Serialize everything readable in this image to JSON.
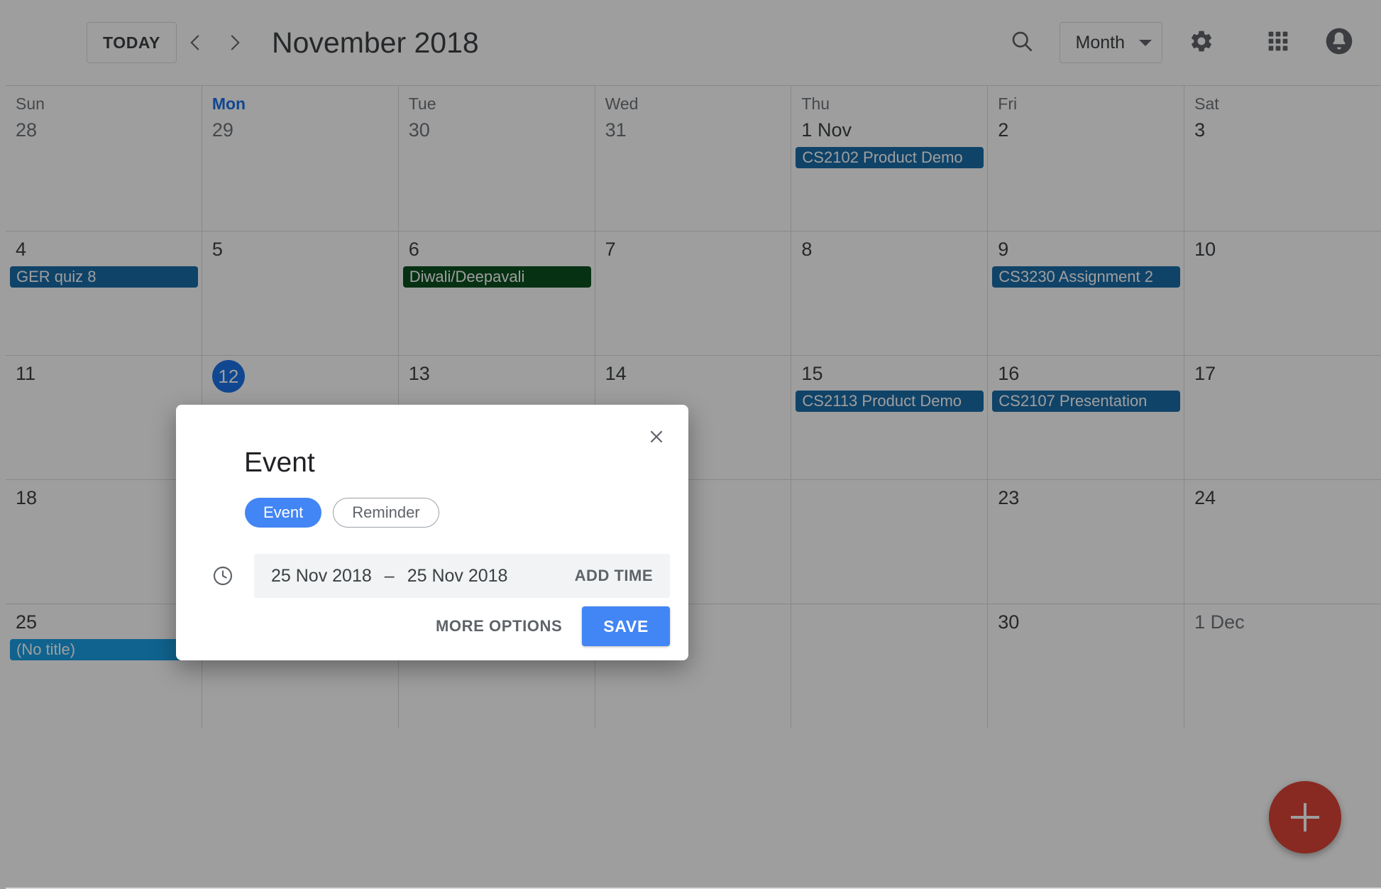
{
  "header": {
    "today_label": "TODAY",
    "prev_icon": "chevron-left-icon",
    "next_icon": "chevron-right-icon",
    "month_title": "November 2018",
    "search_icon": "search-icon",
    "view_label": "Month",
    "settings_icon": "gear-icon",
    "apps_icon": "apps-grid-icon",
    "notifications_icon": "bell-icon"
  },
  "calendar": {
    "day_headers": [
      "Sun",
      "Mon",
      "Tue",
      "Wed",
      "Thu",
      "Fri",
      "Sat"
    ],
    "today_dow_index": 1,
    "weeks": [
      {
        "days": [
          {
            "num": "28",
            "muted": true,
            "today": false,
            "events": []
          },
          {
            "num": "29",
            "muted": true,
            "today": false,
            "events": []
          },
          {
            "num": "30",
            "muted": true,
            "today": false,
            "events": []
          },
          {
            "num": "31",
            "muted": true,
            "today": false,
            "events": []
          },
          {
            "num": "1 Nov",
            "muted": false,
            "today": false,
            "events": [
              {
                "title": "CS2102 Product Demo",
                "color": "#1b6ca8"
              }
            ]
          },
          {
            "num": "2",
            "muted": false,
            "today": false,
            "events": []
          },
          {
            "num": "3",
            "muted": false,
            "today": false,
            "events": []
          }
        ]
      },
      {
        "days": [
          {
            "num": "4",
            "muted": false,
            "today": false,
            "events": [
              {
                "title": "GER quiz 8",
                "color": "#1b6ca8"
              }
            ]
          },
          {
            "num": "5",
            "muted": false,
            "today": false,
            "events": []
          },
          {
            "num": "6",
            "muted": false,
            "today": false,
            "events": [
              {
                "title": "Diwali/Deepavali",
                "color": "#0b5020"
              }
            ]
          },
          {
            "num": "7",
            "muted": false,
            "today": false,
            "events": []
          },
          {
            "num": "8",
            "muted": false,
            "today": false,
            "events": []
          },
          {
            "num": "9",
            "muted": false,
            "today": false,
            "events": [
              {
                "title": "CS3230 Assignment 2",
                "color": "#1b6ca8"
              }
            ]
          },
          {
            "num": "10",
            "muted": false,
            "today": false,
            "events": []
          }
        ]
      },
      {
        "days": [
          {
            "num": "11",
            "muted": false,
            "today": false,
            "events": []
          },
          {
            "num": "12",
            "muted": false,
            "today": true,
            "events": []
          },
          {
            "num": "13",
            "muted": false,
            "today": false,
            "events": []
          },
          {
            "num": "14",
            "muted": false,
            "today": false,
            "events": []
          },
          {
            "num": "15",
            "muted": false,
            "today": false,
            "events": [
              {
                "title": "CS2113 Product Demo",
                "color": "#1b6ca8"
              }
            ]
          },
          {
            "num": "16",
            "muted": false,
            "today": false,
            "events": [
              {
                "title": "CS2107 Presentation",
                "color": "#1b6ca8"
              }
            ]
          },
          {
            "num": "17",
            "muted": false,
            "today": false,
            "events": []
          }
        ]
      },
      {
        "days": [
          {
            "num": "18",
            "muted": false,
            "today": false,
            "events": []
          },
          {
            "num": "",
            "muted": false,
            "today": false,
            "events": []
          },
          {
            "num": "",
            "muted": false,
            "today": false,
            "events": []
          },
          {
            "num": "",
            "muted": false,
            "today": false,
            "events": []
          },
          {
            "num": "",
            "muted": false,
            "today": false,
            "events": []
          },
          {
            "num": "23",
            "muted": false,
            "today": false,
            "events": []
          },
          {
            "num": "24",
            "muted": false,
            "today": false,
            "events": []
          }
        ]
      },
      {
        "days": [
          {
            "num": "25",
            "muted": false,
            "today": false,
            "events": [
              {
                "title": "(No title)",
                "color": "#1aa0e6"
              }
            ]
          },
          {
            "num": "",
            "muted": false,
            "today": false,
            "events": []
          },
          {
            "num": "",
            "muted": false,
            "today": false,
            "events": []
          },
          {
            "num": "",
            "muted": false,
            "today": false,
            "events": []
          },
          {
            "num": "",
            "muted": false,
            "today": false,
            "events": []
          },
          {
            "num": "30",
            "muted": false,
            "today": false,
            "events": []
          },
          {
            "num": "1 Dec",
            "muted": true,
            "today": false,
            "events": []
          }
        ]
      }
    ]
  },
  "fab": {
    "icon": "plus-icon",
    "color": "#db4437"
  },
  "modal": {
    "close_icon": "close-icon",
    "title": "Event",
    "tabs": [
      {
        "label": "Event",
        "active": true
      },
      {
        "label": "Reminder",
        "active": false
      }
    ],
    "clock_icon": "clock-icon",
    "date_start": "25 Nov 2018",
    "date_separator": "–",
    "date_end": "25 Nov 2018",
    "add_time_label": "ADD TIME",
    "more_options_label": "MORE OPTIONS",
    "save_label": "SAVE"
  },
  "colors": {
    "accent_blue": "#4285f4",
    "today_blue": "#1a73e8",
    "event_blue": "#1b6ca8",
    "holiday_green": "#0b5020",
    "notitle_blue": "#1aa0e6",
    "fab_red": "#db4437"
  }
}
